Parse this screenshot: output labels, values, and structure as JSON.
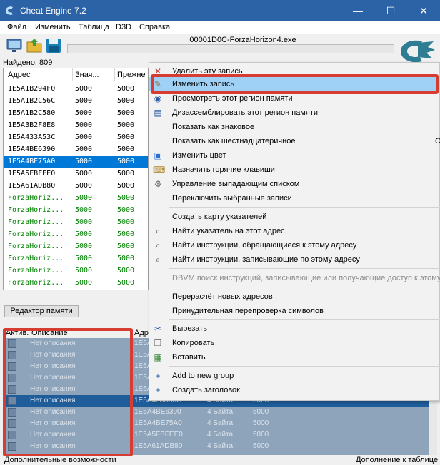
{
  "window": {
    "title": "Cheat Engine 7.2",
    "min_symbol": "—",
    "max_symbol": "☐",
    "close_symbol": "✕"
  },
  "menubar": [
    "Файл",
    "Изменить",
    "Таблица",
    "D3D",
    "Справка"
  ],
  "process_name": "00001D0C-ForzaHorizon4.exe",
  "found_label": "Найдено: 809",
  "results": {
    "headers": [
      "Адрес",
      "Знач...",
      "Прежне"
    ],
    "rows": [
      {
        "addr": "1E5A1B294F0",
        "val": "5000",
        "prev": "5000"
      },
      {
        "addr": "1E5A1B2C56C",
        "val": "5000",
        "prev": "5000"
      },
      {
        "addr": "1E5A1B2C580",
        "val": "5000",
        "prev": "5000"
      },
      {
        "addr": "1E5A3B2F8E8",
        "val": "5000",
        "prev": "5000"
      },
      {
        "addr": "1E5A433A53C",
        "val": "5000",
        "prev": "5000"
      },
      {
        "addr": "1E5A4BE6390",
        "val": "5000",
        "prev": "5000"
      },
      {
        "addr": "1E5A4BE75A0",
        "val": "5000",
        "prev": "5000"
      },
      {
        "addr": "1E5A5FBFEE0",
        "val": "5000",
        "prev": "5000"
      },
      {
        "addr": "1E5A61ADB80",
        "val": "5000",
        "prev": "5000"
      },
      {
        "addr": "ForzaHoriz...",
        "val": "5000",
        "prev": "5000"
      },
      {
        "addr": "ForzaHoriz...",
        "val": "5000",
        "prev": "5000"
      },
      {
        "addr": "ForzaHoriz...",
        "val": "5000",
        "prev": "5000"
      },
      {
        "addr": "ForzaHoriz...",
        "val": "5000",
        "prev": "5000"
      },
      {
        "addr": "ForzaHoriz...",
        "val": "5000",
        "prev": "5000"
      },
      {
        "addr": "ForzaHoriz...",
        "val": "5000",
        "prev": "5000"
      },
      {
        "addr": "ForzaHoriz...",
        "val": "5000",
        "prev": "5000"
      },
      {
        "addr": "ForzaHoriz...",
        "val": "5000",
        "prev": "5000"
      }
    ]
  },
  "memory_view_button": "Редактор памяти",
  "table": {
    "headers": [
      "Актив.",
      "Описание",
      "Адре"
    ],
    "rows": [
      {
        "desc": "Нет описания",
        "addr": "1E5A",
        "type": "",
        "value": ""
      },
      {
        "desc": "Нет описания",
        "addr": "1E5A",
        "type": "",
        "value": ""
      },
      {
        "desc": "Нет описания",
        "addr": "1E5A",
        "type": "",
        "value": ""
      },
      {
        "desc": "Нет описания",
        "addr": "1E5A",
        "type": "",
        "value": ""
      },
      {
        "desc": "Нет описания",
        "addr": "1E5A",
        "type": "",
        "value": ""
      },
      {
        "desc": "Нет описания",
        "addr": "1E5A433A53C",
        "type": "4 Байта",
        "value": "5000"
      },
      {
        "desc": "Нет описания",
        "addr": "1E5A4BE6390",
        "type": "4 Байта",
        "value": "5000"
      },
      {
        "desc": "Нет описания",
        "addr": "1E5A4BE75A0",
        "type": "4 Байта",
        "value": "5000"
      },
      {
        "desc": "Нет описания",
        "addr": "1E5A5FBFEE0",
        "type": "4 Байта",
        "value": "5000"
      },
      {
        "desc": "Нет описания",
        "addr": "1E5A61ADB80",
        "type": "4 Байта",
        "value": "5000"
      }
    ]
  },
  "status": {
    "left": "Дополнительные возможности",
    "right": "Дополнение к таблице"
  },
  "context_menu": {
    "items": [
      {
        "label": "Удалить эту запись",
        "icon": "✕",
        "icon_name": "delete-icon",
        "icon_color": "#d0312d"
      },
      {
        "label": "Изменить запись",
        "icon": "✎",
        "icon_name": "edit-icon",
        "icon_color": "#8a6d3b"
      },
      {
        "label": "Просмотреть этот регион памяти",
        "icon": "◉",
        "icon_name": "binoculars-icon",
        "icon_color": "#2d5ea8"
      },
      {
        "label": "Дизассемблировать этот регион памяти",
        "icon": "▤",
        "icon_name": "disassemble-icon",
        "icon_color": "#2d5ea8"
      },
      {
        "label": "Показать как знаковое",
        "icon": "",
        "icon_name": "",
        "icon_color": ""
      },
      {
        "label": "Показать как шестнадцатеричное",
        "icon": "",
        "icon_name": "",
        "icon_color": ""
      },
      {
        "label": "Изменить цвет",
        "icon": "▣",
        "icon_name": "color-icon",
        "icon_color": "#2c6fd1"
      },
      {
        "label": "Назначить горячие клавиши",
        "icon": "⌨",
        "icon_name": "hotkey-icon",
        "icon_color": "#b08a2d"
      },
      {
        "label": "Управление выпадающим списком",
        "icon": "⚙",
        "icon_name": "gear-icon",
        "icon_color": "#666666"
      },
      {
        "label": "Переключить выбранные записи",
        "icon": "",
        "icon_name": "",
        "icon_color": ""
      },
      {
        "label": "Создать карту указателей",
        "icon": "",
        "icon_name": "",
        "icon_color": ""
      },
      {
        "label": "Найти указатель на этот адрес",
        "icon": "⌕",
        "icon_name": "search-pointer-icon",
        "icon_color": "#444444"
      },
      {
        "label": "Найти инструкции, обращающиеся к этому адресу",
        "icon": "⌕",
        "icon_name": "search-access-icon",
        "icon_color": "#444444"
      },
      {
        "label": "Найти инструкции, записывающие по этому адресу",
        "icon": "⌕",
        "icon_name": "search-write-icon",
        "icon_color": "#444444"
      },
      {
        "label": "DBVM поиск инструкций, записывающие или получающие доступ к этому",
        "icon": "",
        "icon_name": "",
        "icon_color": ""
      },
      {
        "label": "Перерасчёт новых адресов",
        "icon": "",
        "icon_name": "",
        "icon_color": ""
      },
      {
        "label": "Принудительная перепроверка символов",
        "icon": "",
        "icon_name": "",
        "icon_color": ""
      },
      {
        "label": "Вырезать",
        "icon": "✂",
        "icon_name": "cut-icon",
        "icon_color": "#2d5ea8"
      },
      {
        "label": "Копировать",
        "icon": "❐",
        "icon_name": "copy-icon",
        "icon_color": "#555555"
      },
      {
        "label": "Вставить",
        "icon": "▦",
        "icon_name": "paste-icon",
        "icon_color": "#3a8a3a"
      },
      {
        "label": "Add to new group",
        "icon": "+",
        "icon_name": "plus-icon",
        "icon_color": "#2d5ea8"
      },
      {
        "label": "Создать заголовок",
        "icon": "+",
        "icon_name": "plus-icon",
        "icon_color": "#2d5ea8"
      }
    ],
    "right_overflow": "C"
  },
  "colors": {
    "title_bar": "#2b63a6",
    "selection": "#0078d7",
    "highlight_frame": "#d73c33",
    "menu_hover": "#9fd0f5"
  }
}
